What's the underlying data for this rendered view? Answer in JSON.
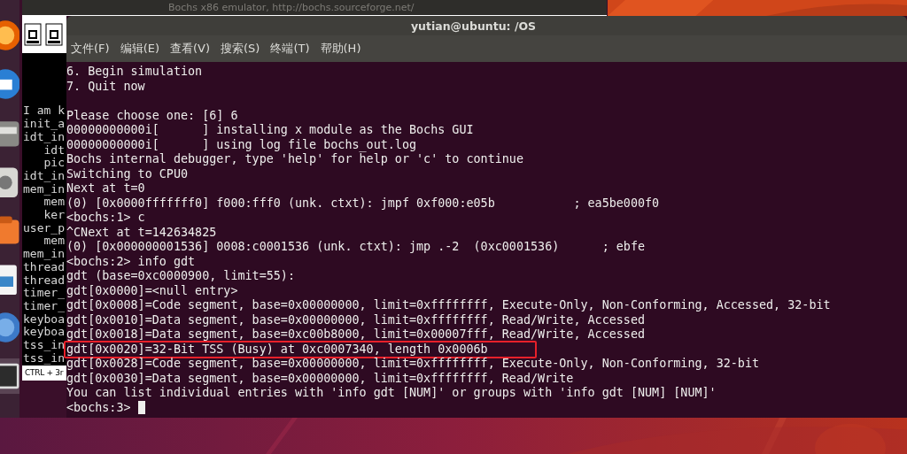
{
  "bochs_window": {
    "title": "Bochs x86 emulator, http://bochs.sourceforge.net/",
    "console_lines": [
      "I am k",
      "init_a",
      "idt_in",
      "   idt",
      "   pic",
      "idt_in",
      "mem_in",
      "   mem",
      "   ker",
      "user_p",
      "   mem",
      "mem_in",
      "thread",
      "thread",
      "timer_",
      "timer_",
      "keyboa",
      "keyboa",
      "tss_in",
      "tss_in"
    ],
    "status": "CTRL + 3r"
  },
  "terminal": {
    "title": "yutian@ubuntu: /OS",
    "menu": [
      "文件(F)",
      "编辑(E)",
      "查看(V)",
      "搜索(S)",
      "终端(T)",
      "帮助(H)"
    ],
    "lines": [
      {
        "text": "6. Begin simulation",
        "boxed": false
      },
      {
        "text": "7. Quit now",
        "boxed": false
      },
      {
        "boxed": false
      },
      {
        "text": "Please choose one: [6] 6",
        "boxed": false
      },
      {
        "text": "00000000000i[      ] installing x module as the Bochs GUI",
        "boxed": false
      },
      {
        "text": "00000000000i[      ] using log file bochs_out.log",
        "boxed": false
      },
      {
        "text": "Bochs internal debugger, type 'help' for help or 'c' to continue",
        "boxed": false
      },
      {
        "text": "Switching to CPU0",
        "boxed": false
      },
      {
        "text": "Next at t=0",
        "boxed": false
      },
      {
        "text": "(0) [0x0000fffffff0] f000:fff0 (unk. ctxt): jmpf 0xf000:e05b           ; ea5be000f0",
        "boxed": false
      },
      {
        "text": "<bochs:1> c",
        "boxed": false
      },
      {
        "text": "^CNext at t=142634825",
        "boxed": false
      },
      {
        "text": "(0) [0x000000001536] 0008:c0001536 (unk. ctxt): jmp .-2  (0xc0001536)      ; ebfe",
        "boxed": false
      },
      {
        "text": "<bochs:2> info gdt",
        "boxed": false
      },
      {
        "text": "gdt (base=0xc0000900, limit=55):",
        "boxed": false
      },
      {
        "text": "gdt[0x0000]=<null entry>",
        "boxed": false
      },
      {
        "text": "gdt[0x0008]=Code segment, base=0x00000000, limit=0xffffffff, Execute-Only, Non-Conforming, Accessed, 32-bit",
        "boxed": false
      },
      {
        "text": "gdt[0x0010]=Data segment, base=0x00000000, limit=0xffffffff, Read/Write, Accessed",
        "boxed": false
      },
      {
        "text": "gdt[0x0018]=Data segment, base=0xc00b8000, limit=0x00007fff, Read/Write, Accessed",
        "boxed": false
      },
      {
        "text": "gdt[0x0020]=32-Bit TSS (Busy) at 0xc0007340, length 0x0006b",
        "boxed": true
      },
      {
        "text": "gdt[0x0028]=Code segment, base=0x00000000, limit=0xffffffff, Execute-Only, Non-Conforming, 32-bit",
        "boxed": false
      },
      {
        "text": "gdt[0x0030]=Data segment, base=0x00000000, limit=0xffffffff, Read/Write",
        "boxed": false
      },
      {
        "text": "You can list individual entries with 'info gdt [NUM]' or groups with 'info gdt [NUM] [NUM]'",
        "boxed": false
      }
    ],
    "prompt": "<bochs:3>"
  },
  "dock": {
    "items": [
      {
        "kind": "browser",
        "selected": false
      },
      {
        "kind": "mail",
        "selected": false
      },
      {
        "kind": "files",
        "selected": false
      },
      {
        "kind": "disk",
        "selected": false
      },
      {
        "kind": "store",
        "selected": false
      },
      {
        "kind": "document",
        "selected": false
      },
      {
        "kind": "help",
        "selected": false
      },
      {
        "kind": "terminal",
        "selected": true
      }
    ]
  }
}
